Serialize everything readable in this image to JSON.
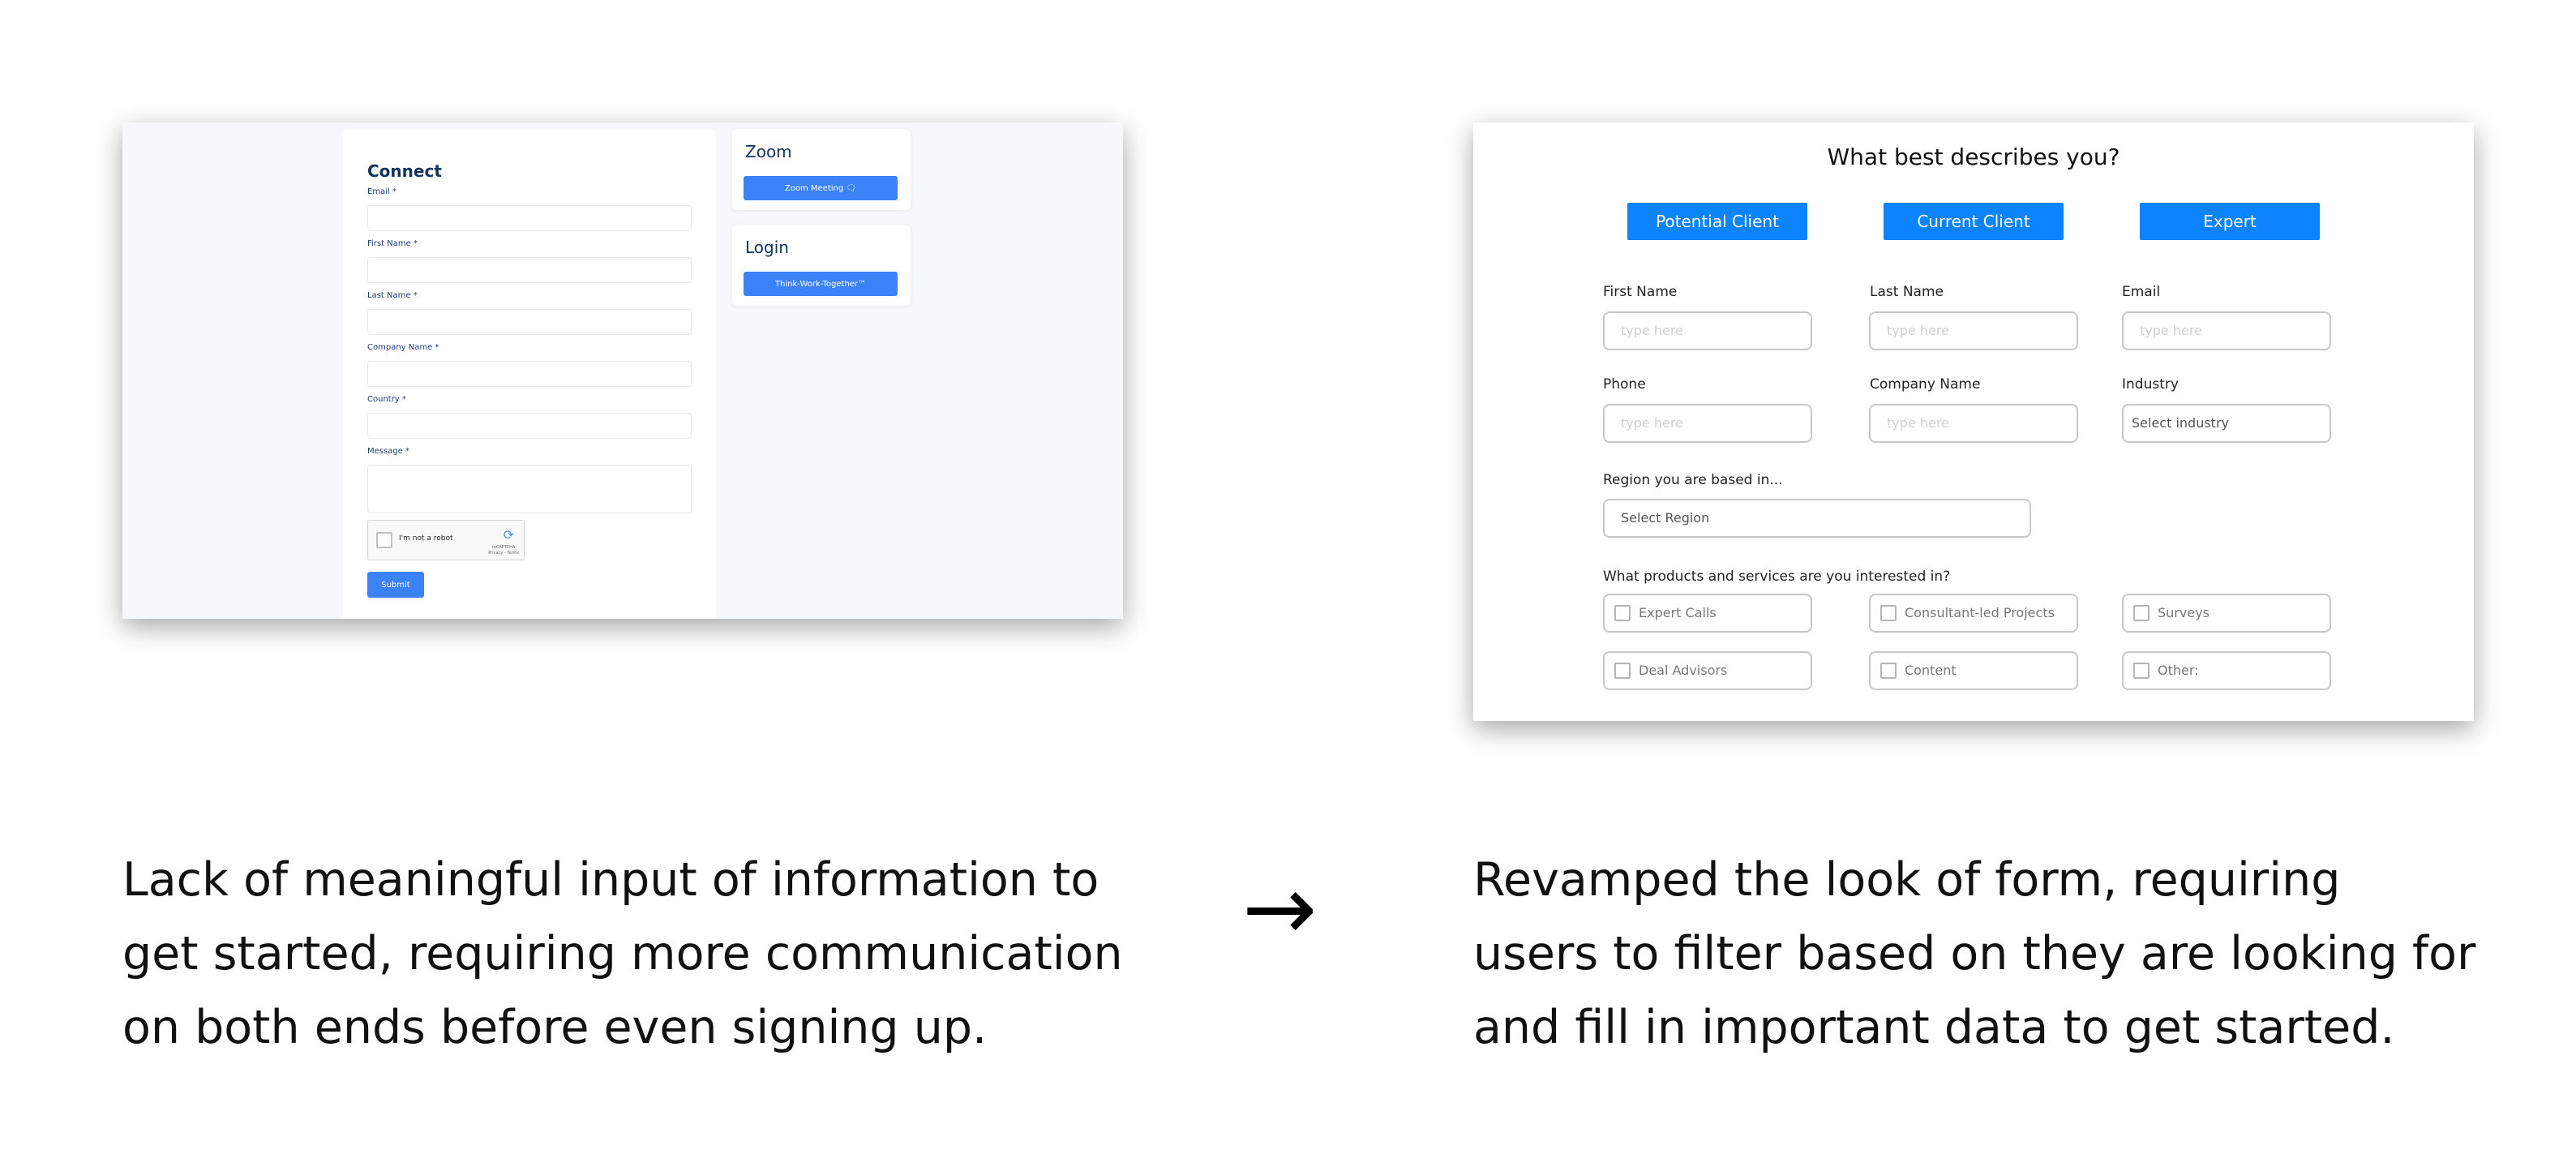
{
  "old_form": {
    "title": "Connect",
    "fields": [
      {
        "label": "Email *"
      },
      {
        "label": "First Name *"
      },
      {
        "label": "Last Name *"
      },
      {
        "label": "Company Name *"
      },
      {
        "label": "Country *"
      },
      {
        "label": "Message *"
      }
    ],
    "recaptcha": {
      "label": "I'm not a robot",
      "brand": "reCAPTCHA",
      "small": "Privacy - Terms"
    },
    "submit_label": "Submit",
    "zoom": {
      "title": "Zoom",
      "button_label": "Zoom Meeting 🗨"
    },
    "login": {
      "title": "Login",
      "button_label": "Think-Work-Together™"
    },
    "accent_color": "#3b82f6"
  },
  "new_form": {
    "title": "What best describes you?",
    "roles": [
      "Potential Client",
      "Current Client",
      "Expert"
    ],
    "fields": {
      "first_name": {
        "label": "First Name",
        "placeholder": "type here"
      },
      "last_name": {
        "label": "Last Name",
        "placeholder": "type here"
      },
      "email": {
        "label": "Email",
        "placeholder": "type here"
      },
      "phone": {
        "label": "Phone",
        "placeholder": "type here"
      },
      "company": {
        "label": "Company Name",
        "placeholder": "type here"
      },
      "industry": {
        "label": "Industry",
        "placeholder": "Select industry"
      },
      "region": {
        "label": "Region you are based in...",
        "placeholder": "Select Region"
      }
    },
    "products": {
      "label": "What products and services are you interested in?",
      "options": [
        "Expert Calls",
        "Consultant-led Projects",
        "Surveys",
        "Deal Advisors",
        "Content",
        "Other:"
      ]
    },
    "accent_color": "#0d84ff"
  },
  "captions": {
    "before": "Lack of meaningful input of information to get started, requiring more communication on both ends before even signing up.",
    "arrow": "→",
    "after": "Revamped the look of form, requiring users to filter based on they are looking for and fill in important data to get started."
  }
}
